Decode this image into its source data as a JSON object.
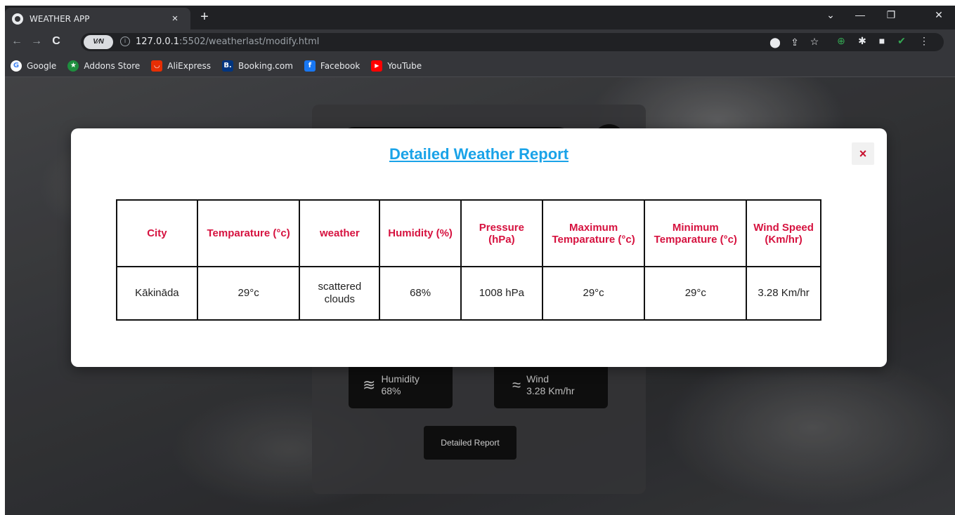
{
  "browser": {
    "tab_title": "WEATHER APP",
    "tab_close": "×",
    "new_tab": "+",
    "url_host": "127.0.0.1",
    "url_rest": ":5502/weatherlast/modify.html",
    "vpn_label": "V⁄N",
    "bookmarks": [
      {
        "label": "Google",
        "icon_color": "#4285f4",
        "icon_text": "G"
      },
      {
        "label": "Addons Store",
        "icon_color": "#1e8e3e",
        "icon_text": "★"
      },
      {
        "label": "AliExpress",
        "icon_color": "#e62e04",
        "icon_text": "◡"
      },
      {
        "label": "Booking.com",
        "icon_color": "#003580",
        "icon_text": "B."
      },
      {
        "label": "Facebook",
        "icon_color": "#1877f2",
        "icon_text": "f"
      },
      {
        "label": "YouTube",
        "icon_color": "#ff0000",
        "icon_text": "▶"
      }
    ]
  },
  "background_card": {
    "humidity_label": "Humidity",
    "humidity_value": "68%",
    "wind_label": "Wind",
    "wind_value": "3.28 Km/hr",
    "report_button": "Detailed Report"
  },
  "modal": {
    "title": "Detailed Weather Report",
    "close": "×",
    "columns": [
      "City",
      "Temparature (°c)",
      "weather",
      "Humidity (%)",
      "Pressure (hPa)",
      "Maximum Temparature (°c)",
      "Minimum Temparature (°c)",
      "Wind Speed (Km/hr)"
    ],
    "row": [
      "Kākināda",
      "29°c",
      "scattered clouds",
      "68%",
      "1008 hPa",
      "29°c",
      "29°c",
      "3.28 Km/hr"
    ]
  },
  "colors": {
    "title_blue": "#1aa3e8",
    "header_red": "#d6123f",
    "close_red": "#c8102e"
  }
}
